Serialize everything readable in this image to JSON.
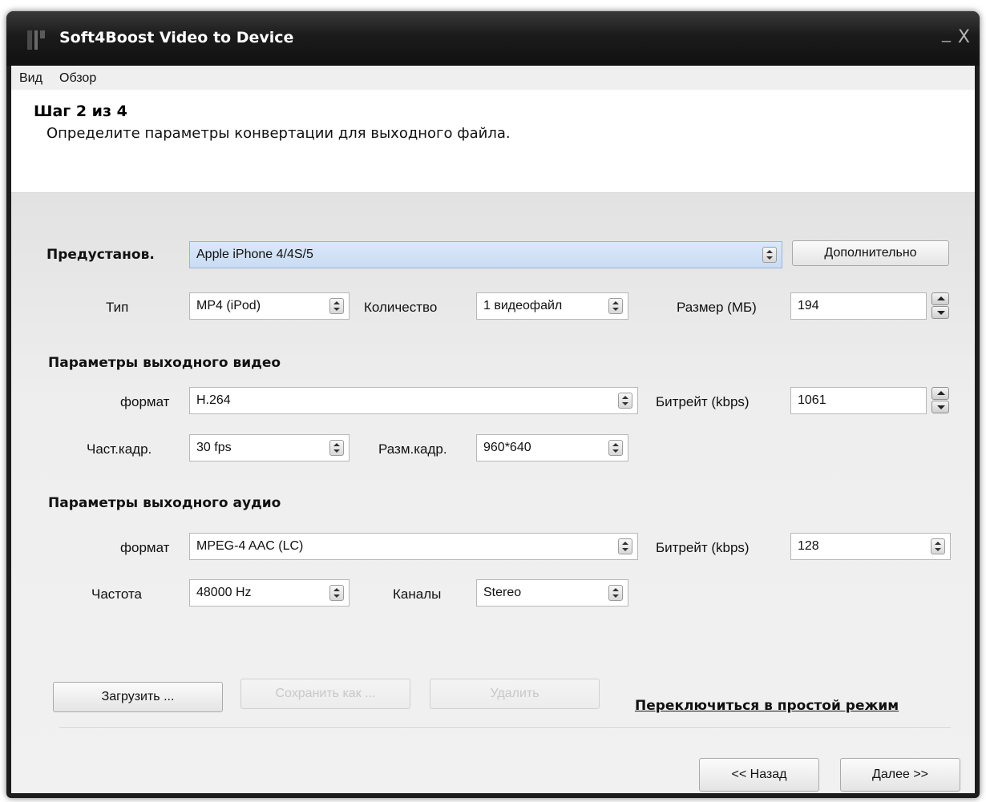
{
  "window": {
    "title": "Soft4Boost Video to Device",
    "minimize": "_",
    "close": "X"
  },
  "menu": {
    "items": [
      "Вид",
      "Обзор"
    ]
  },
  "step": {
    "title": "Шаг 2 из 4",
    "description": "Определите параметры конвертации для выходного файла."
  },
  "preset": {
    "label": "Предустанов.",
    "value": "Apple iPhone 4/4S/5",
    "advanced_button": "Дополнительно"
  },
  "general": {
    "type_label": "Тип",
    "type_value": "MP4 (iPod)",
    "count_label": "Количество",
    "count_value": "1 видеофайл",
    "size_label": "Размер (МБ)",
    "size_value": "194"
  },
  "video": {
    "section_title": "Параметры выходного видео",
    "format_label": "формат",
    "format_value": "H.264",
    "bitrate_label": "Битрейт (kbps)",
    "bitrate_value": "1061",
    "framerate_label": "Част.кадр.",
    "framerate_value": "30 fps",
    "framesize_label": "Разм.кадр.",
    "framesize_value": "960*640"
  },
  "audio": {
    "section_title": "Параметры выходного аудио",
    "format_label": "формат",
    "format_value": "MPEG-4 AAC (LC)",
    "bitrate_label": "Битрейт (kbps)",
    "bitrate_value": "128",
    "frequency_label": "Частота",
    "frequency_value": "48000 Hz",
    "channels_label": "Каналы",
    "channels_value": "Stereo"
  },
  "actions": {
    "load_button": "Загрузить ...",
    "save_button": "Сохранить как ...",
    "delete_button": "Удалить",
    "simple_mode_link": "Переключиться в простой режим"
  },
  "nav": {
    "back_button": "<< Назад",
    "next_button": "Далее >>"
  }
}
